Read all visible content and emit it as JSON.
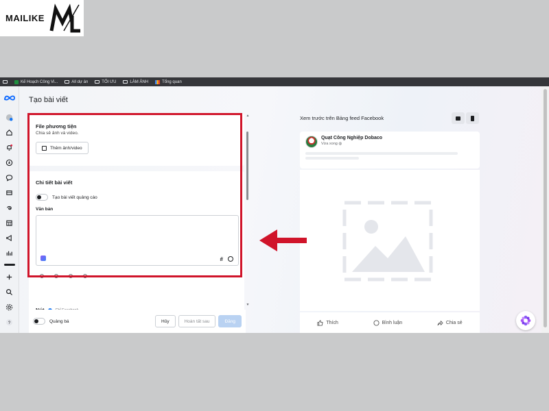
{
  "watermark": {
    "text": "MAILIKE"
  },
  "bookmarks": [
    {
      "label": "Kế Hoạch Công Vi...",
      "kind": "sheet"
    },
    {
      "label": "All dự án",
      "kind": "folder"
    },
    {
      "label": "TỐI ƯU",
      "kind": "folder"
    },
    {
      "label": "LÀM ẢNH",
      "kind": "folder"
    },
    {
      "label": "Tổng quan",
      "kind": "chart"
    }
  ],
  "nav_icons": [
    "home-icon",
    "bell-icon",
    "compass-icon",
    "chat-icon",
    "pages-icon",
    "threads-icon",
    "calendar-icon",
    "megaphone-icon",
    "insights-icon",
    "plus-icon",
    "search-icon",
    "settings-icon",
    "help-icon"
  ],
  "page": {
    "title": "Tạo bài viết"
  },
  "media_section": {
    "title": "File phương tiện",
    "subtitle": "Chia sẻ ảnh và video.",
    "add_button": "Thêm ảnh/video"
  },
  "details_section": {
    "title": "Chi tiết bài viết",
    "ad_toggle_label": "Tạo bài viết quảng cáo",
    "text_label": "Văn bản",
    "hash_symbol": "#"
  },
  "button_section": {
    "title": "Nút",
    "only_facebook": "Chỉ Facebook"
  },
  "footer": {
    "boost_label": "Quảng bá",
    "cancel": "Hủy",
    "finish_later": "Hoàn tất sau",
    "publish": "Đăng"
  },
  "preview": {
    "title": "Xem trước trên Bảng feed Facebook",
    "page_name": "Quạt Công Nghiệp Dobaco",
    "post_time": "Vừa xong",
    "actions": {
      "like": "Thích",
      "comment": "Bình luận",
      "share": "Chia sẻ"
    }
  },
  "colors": {
    "highlight": "#d0142a",
    "facebook_blue": "#1877f2",
    "publish_disabled": "#b9d2f2"
  }
}
